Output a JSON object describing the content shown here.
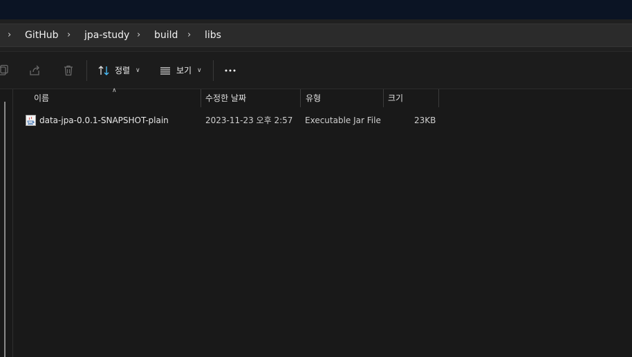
{
  "breadcrumb": {
    "items": [
      "GitHub",
      "jpa-study",
      "build",
      "libs"
    ]
  },
  "toolbar": {
    "sort_label": "정렬",
    "view_label": "보기",
    "icons": [
      "copy-icon",
      "share-icon",
      "delete-icon",
      "sort-icon",
      "view-list-icon",
      "more-icon"
    ]
  },
  "columns": {
    "name": "이름",
    "date": "수정한 날짜",
    "type": "유형",
    "size": "크기"
  },
  "files": [
    {
      "name": "data-jpa-0.0.1-SNAPSHOT-plain",
      "date": "2023-11-23 오후 2:57",
      "type": "Executable Jar File",
      "size": "23KB",
      "icon": "jar-file-icon"
    }
  ],
  "colors": {
    "titlebar": "#0b1424",
    "background": "#191919",
    "accent": "#4cc2ff"
  }
}
